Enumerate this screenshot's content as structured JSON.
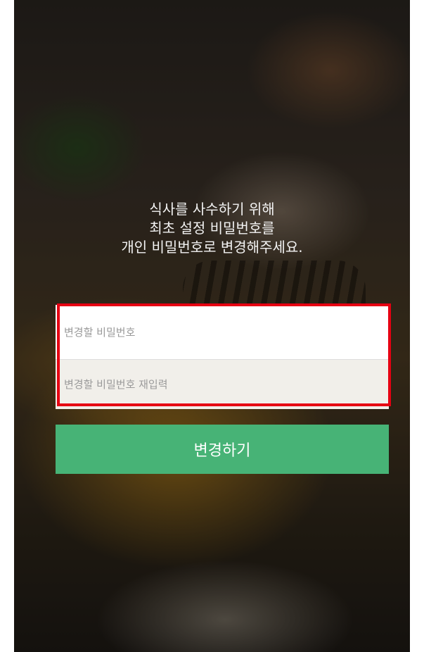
{
  "message": {
    "line1": "식사를 사수하기 위해",
    "line2": "최초 설정 비밀번호를",
    "line3": "개인 비밀번호로 변경해주세요."
  },
  "form": {
    "new_password_placeholder": "변경할 비밀번호",
    "confirm_password_placeholder": "변경할 비밀번호 재입력",
    "submit_label": "변경하기"
  },
  "colors": {
    "accent": "#47b376",
    "highlight": "#e60012"
  }
}
